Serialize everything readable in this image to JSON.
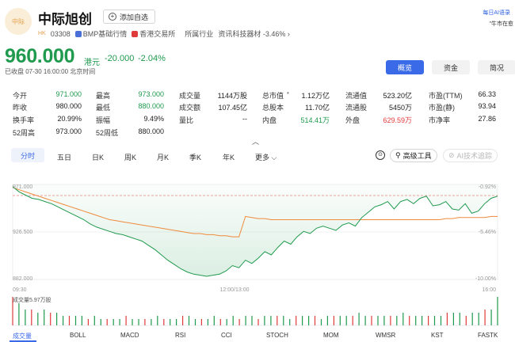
{
  "header": {
    "logo_text": "中际",
    "name": "中际旭创",
    "watch_label": "添加自选",
    "market": "HK",
    "code": "03308",
    "bmp_label": "BMP基础行情",
    "exchange_label": "香港交易所",
    "industry_label": "所属行业",
    "industry_name": "资讯科技器材",
    "industry_change": "-3.46%",
    "corner_link": "每日AI语录",
    "corner_text": "\"牛市在愈"
  },
  "price": {
    "value": "960.000",
    "unit": "港元",
    "change": "-20.000",
    "change_pct": "-2.04%",
    "close_info": "已收盘 07-30 16:00:00 北京时间"
  },
  "tabs": [
    "概览",
    "资金",
    "简况"
  ],
  "stats": [
    [
      {
        "label": "今开",
        "value": "971.000",
        "color": "green"
      },
      {
        "label": "最高",
        "value": "973.000",
        "color": "green"
      },
      {
        "label": "成交量",
        "value": "1144万股"
      },
      {
        "label": "总市值",
        "value": "1.12万亿",
        "dot": true
      },
      {
        "label": "流通值",
        "value": "523.20亿"
      },
      {
        "label": "市盈(TTM)",
        "value": "66.33"
      }
    ],
    [
      {
        "label": "昨收",
        "value": "980.000"
      },
      {
        "label": "最低",
        "value": "880.000",
        "color": "green"
      },
      {
        "label": "成交额",
        "value": "107.45亿"
      },
      {
        "label": "总股本",
        "value": "11.70亿"
      },
      {
        "label": "流通股",
        "value": "5450万"
      },
      {
        "label": "市盈(静)",
        "value": "93.94"
      }
    ],
    [
      {
        "label": "换手率",
        "value": "20.99%"
      },
      {
        "label": "振幅",
        "value": "9.49%"
      },
      {
        "label": "量比",
        "value": "--"
      },
      {
        "label": "内盘",
        "value": "514.41万",
        "color": "green"
      },
      {
        "label": "外盘",
        "value": "629.59万",
        "color": "red"
      },
      {
        "label": "市净率",
        "value": "27.86"
      }
    ],
    [
      {
        "label": "52周高",
        "value": "973.000"
      },
      {
        "label": "52周低",
        "value": "880.000"
      }
    ]
  ],
  "periods": [
    "分时",
    "五日",
    "日K",
    "周K",
    "月K",
    "季K",
    "年K",
    "更多"
  ],
  "tools": {
    "advanced": "高级工具",
    "ai": "AI技术追踪"
  },
  "colors": {
    "down": "#1f9a4e",
    "up": "#e03b3b",
    "accent": "#3a6ae8",
    "avg_line": "#f08a3c"
  },
  "chart_data": {
    "type": "line",
    "y_left_ticks": [
      "971.000",
      "926.500",
      "882.000"
    ],
    "y_right_ticks": [
      "-0.92%",
      "-5.46%",
      "-10.00%"
    ],
    "x_ticks": [
      "09:30",
      "12:00/13:00",
      "16:00"
    ],
    "ylim": [
      882,
      971
    ],
    "prev_close": 980,
    "series": [
      {
        "values": [
          969,
          964,
          961,
          958,
          957,
          955,
          953,
          950,
          947,
          944,
          941,
          938,
          934,
          931,
          929,
          927,
          925,
          924,
          922,
          920,
          918,
          914,
          910,
          905,
          900,
          896,
          892,
          889,
          887,
          886,
          885,
          886,
          887,
          890,
          895,
          893,
          900,
          897,
          902,
          908,
          905,
          912,
          918,
          915,
          922,
          927,
          925,
          930,
          932,
          930,
          928,
          933,
          935,
          932,
          940,
          945,
          950,
          952,
          955,
          948,
          955,
          957,
          953,
          958,
          960,
          951,
          952,
          955,
          948,
          947,
          953,
          944,
          946,
          953,
          958,
          960
        ]
      },
      {
        "values": [
          968,
          966,
          964,
          962,
          960,
          958,
          956,
          954,
          952,
          950,
          948,
          946,
          944,
          942,
          940,
          938,
          937,
          936,
          935,
          934,
          933,
          932,
          931,
          930,
          929,
          928,
          927,
          926,
          925,
          925,
          924,
          924,
          923,
          923,
          922,
          922,
          941,
          940,
          939,
          939,
          938,
          938,
          938,
          938,
          938,
          938,
          938,
          938,
          938,
          938,
          938,
          938,
          938,
          938,
          938,
          938,
          938,
          938,
          938,
          938,
          938,
          938,
          938,
          938,
          938,
          938,
          938,
          939,
          939,
          940,
          940,
          940,
          940,
          940,
          941,
          941
        ]
      }
    ],
    "volume_label": "成交量5.97万股",
    "volume_values": [
      9,
      7,
      5,
      5,
      4,
      5,
      4,
      4,
      3,
      3,
      3,
      3,
      2,
      3,
      2,
      2,
      2,
      2,
      3,
      2,
      2,
      2,
      2,
      3,
      2,
      2,
      2,
      3,
      3,
      2,
      2,
      2,
      3,
      2,
      2,
      3,
      2,
      3,
      3,
      2,
      3,
      3,
      3,
      3,
      2,
      3,
      3,
      3,
      3,
      2,
      3,
      3,
      3,
      3,
      3,
      4,
      3,
      3,
      3,
      3,
      3,
      3,
      4,
      3,
      3,
      3,
      3,
      3,
      3,
      4,
      4,
      4,
      3,
      4,
      4,
      5,
      5,
      9
    ]
  },
  "indicators": [
    "成交量",
    "BOLL",
    "MACD",
    "RSI",
    "CCI",
    "STOCH",
    "MOM",
    "WMSR",
    "KST",
    "FASTK"
  ]
}
